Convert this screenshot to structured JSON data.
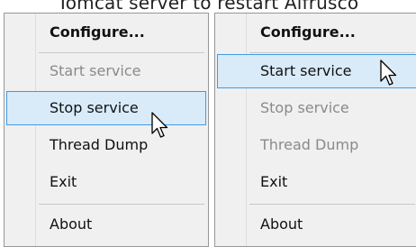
{
  "caption": "Tomcat server to restart Alfrusco",
  "left_menu": {
    "items": [
      {
        "label": "Configure...",
        "state": "bold"
      },
      {
        "label": "Start service",
        "state": "disabled"
      },
      {
        "label": "Stop service",
        "state": "highlighted"
      },
      {
        "label": "Thread Dump",
        "state": "normal"
      },
      {
        "label": "Exit",
        "state": "normal"
      },
      {
        "label": "About",
        "state": "normal"
      }
    ]
  },
  "right_menu": {
    "items": [
      {
        "label": "Configure...",
        "state": "bold"
      },
      {
        "label": "Start service",
        "state": "highlighted"
      },
      {
        "label": "Stop service",
        "state": "disabled"
      },
      {
        "label": "Thread Dump",
        "state": "disabled"
      },
      {
        "label": "Exit",
        "state": "normal"
      },
      {
        "label": "About",
        "state": "normal"
      }
    ]
  },
  "colors": {
    "highlight_bg": "#d9ebf9",
    "highlight_border": "#3f9be3",
    "menu_bg": "#f0f0f0",
    "disabled_text": "#8a8a8a"
  },
  "icons": {
    "cursor": "arrow-cursor-icon"
  }
}
